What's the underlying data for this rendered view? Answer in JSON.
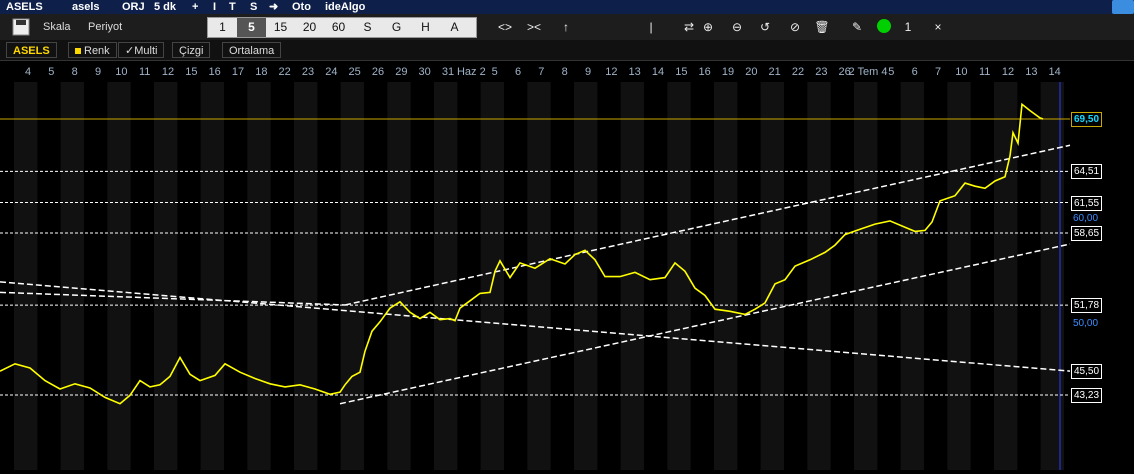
{
  "topbar": {
    "tabs": [
      "ASELS",
      "asels",
      "ORJ",
      "5 dk",
      "+",
      "I",
      "T",
      "S",
      "➜",
      "Oto",
      "ideAlgo"
    ]
  },
  "toolbar": {
    "scale_label": "Skala",
    "period_label": "Periyot",
    "periods": [
      "1",
      "5",
      "15",
      "20",
      "60",
      "S",
      "G",
      "H",
      "A"
    ],
    "selected_period": "5",
    "tools": [
      "<>",
      "><",
      "↑",
      "|",
      "⇄",
      "⊕",
      "⊖",
      "↺",
      "⊘",
      "🗑",
      "✎",
      "●",
      "1",
      "×"
    ],
    "status_dot_color": "#00d000",
    "line_width_value": "1"
  },
  "subtabs": {
    "symbol": "ASELS",
    "renk": "Renk",
    "multi": "Multi",
    "cizgi": "Çizgi",
    "ortalama": "Ortalama"
  },
  "chart_data": {
    "type": "line",
    "x_dates": [
      "4",
      "5",
      "8",
      "9",
      "10",
      "11",
      "12",
      "15",
      "16",
      "17",
      "18",
      "22",
      "23",
      "24",
      "25",
      "26",
      "29",
      "30",
      "31",
      "Haz 2",
      "5",
      "6",
      "7",
      "8",
      "9",
      "12",
      "13",
      "14",
      "15",
      "16",
      "19",
      "20",
      "21",
      "22",
      "23",
      "26",
      "2 Tem 4",
      "5",
      "6",
      "7",
      "10",
      "11",
      "12",
      "13",
      "14"
    ],
    "series_color": "#ffff00",
    "price_labels": [
      {
        "value": "69,50",
        "style": "current"
      },
      {
        "value": "64,51",
        "style": "box"
      },
      {
        "value": "61,55",
        "style": "box"
      },
      {
        "value": "60,00",
        "style": "axis"
      },
      {
        "value": "58,65",
        "style": "box"
      },
      {
        "value": "51,78",
        "style": "box"
      },
      {
        "value": "50,00",
        "style": "axis"
      },
      {
        "value": "45,50",
        "style": "box"
      },
      {
        "value": "43,23",
        "style": "box"
      }
    ],
    "price_series": [
      [
        0,
        45.5
      ],
      [
        15,
        46.2
      ],
      [
        30,
        45.8
      ],
      [
        45,
        44.6
      ],
      [
        60,
        43.8
      ],
      [
        75,
        44.3
      ],
      [
        90,
        43.9
      ],
      [
        105,
        43.0
      ],
      [
        120,
        42.4
      ],
      [
        130,
        43.2
      ],
      [
        140,
        44.6
      ],
      [
        150,
        44.0
      ],
      [
        160,
        44.2
      ],
      [
        170,
        45.0
      ],
      [
        180,
        46.8
      ],
      [
        190,
        45.2
      ],
      [
        200,
        44.6
      ],
      [
        215,
        45.1
      ],
      [
        225,
        46.2
      ],
      [
        240,
        45.4
      ],
      [
        255,
        44.8
      ],
      [
        270,
        44.3
      ],
      [
        285,
        44.0
      ],
      [
        300,
        44.2
      ],
      [
        315,
        43.8
      ],
      [
        330,
        43.3
      ],
      [
        340,
        43.5
      ],
      [
        345,
        44.2
      ],
      [
        352,
        45.0
      ],
      [
        360,
        45.4
      ],
      [
        365,
        47.4
      ],
      [
        372,
        49.3
      ],
      [
        380,
        50.2
      ],
      [
        390,
        51.5
      ],
      [
        400,
        52.1
      ],
      [
        410,
        51.1
      ],
      [
        420,
        50.5
      ],
      [
        430,
        51.1
      ],
      [
        440,
        50.4
      ],
      [
        450,
        50.5
      ],
      [
        455,
        50.3
      ],
      [
        460,
        51.5
      ],
      [
        470,
        52.2
      ],
      [
        480,
        52.9
      ],
      [
        490,
        53.0
      ],
      [
        495,
        55.0
      ],
      [
        500,
        56.0
      ],
      [
        510,
        54.4
      ],
      [
        520,
        55.8
      ],
      [
        535,
        55.3
      ],
      [
        550,
        56.2
      ],
      [
        565,
        55.7
      ],
      [
        575,
        56.6
      ],
      [
        585,
        57.0
      ],
      [
        595,
        56.1
      ],
      [
        605,
        54.5
      ],
      [
        620,
        54.5
      ],
      [
        635,
        54.9
      ],
      [
        650,
        54.2
      ],
      [
        665,
        54.4
      ],
      [
        675,
        55.8
      ],
      [
        685,
        55.0
      ],
      [
        695,
        53.4
      ],
      [
        705,
        52.7
      ],
      [
        715,
        51.4
      ],
      [
        730,
        51.2
      ],
      [
        745,
        50.9
      ],
      [
        755,
        51.4
      ],
      [
        765,
        52.0
      ],
      [
        775,
        53.8
      ],
      [
        785,
        54.2
      ],
      [
        795,
        55.5
      ],
      [
        810,
        56.1
      ],
      [
        825,
        56.8
      ],
      [
        835,
        57.5
      ],
      [
        845,
        58.5
      ],
      [
        860,
        59.0
      ],
      [
        875,
        59.5
      ],
      [
        890,
        59.8
      ],
      [
        905,
        59.2
      ],
      [
        915,
        58.8
      ],
      [
        925,
        58.9
      ],
      [
        932,
        59.7
      ],
      [
        940,
        61.7
      ],
      [
        955,
        62.2
      ],
      [
        965,
        63.4
      ],
      [
        975,
        63.1
      ],
      [
        985,
        62.9
      ],
      [
        995,
        63.6
      ],
      [
        1005,
        64.0
      ],
      [
        1010,
        66.0
      ],
      [
        1013,
        68.2
      ],
      [
        1018,
        67.2
      ],
      [
        1022,
        70.9
      ],
      [
        1030,
        70.3
      ],
      [
        1040,
        69.6
      ],
      [
        1043,
        69.5
      ]
    ],
    "trendlines": [
      {
        "from": [
          345,
          51.8
        ],
        "to": [
          1070,
          67.0
        ]
      },
      {
        "from": [
          340,
          42.4
        ],
        "to": [
          1070,
          57.6
        ]
      },
      {
        "from": [
          0,
          54.0
        ],
        "to": [
          1070,
          45.5
        ]
      },
      {
        "from": [
          0,
          53.0
        ],
        "to": [
          345,
          51.8
        ]
      }
    ],
    "horizontal_lines": [
      64.51,
      61.55,
      58.65,
      51.78,
      43.23
    ],
    "current_price": 69.5
  }
}
